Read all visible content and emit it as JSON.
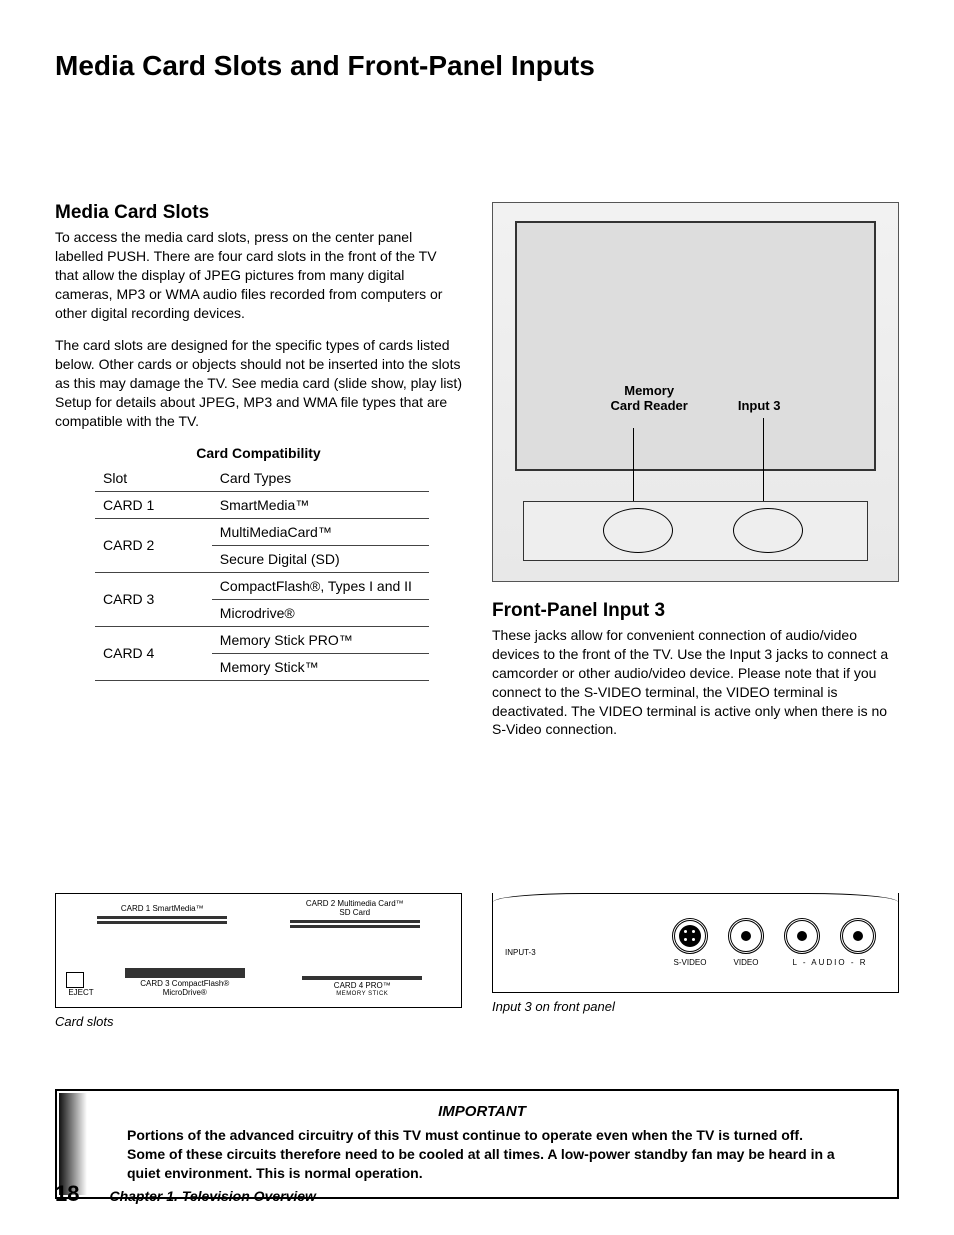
{
  "page_title": "Media Card Slots and Front-Panel Inputs",
  "section_media_slots": {
    "heading": "Media Card Slots",
    "p1": "To access the media card slots, press on the center panel labelled PUSH.  There are four card slots in the front of the TV that allow the display of JPEG pictures from many digital cameras, MP3 or WMA audio files recorded from computers or other digital recording devices.",
    "p2": "The card slots are designed for the specific types of cards listed below.  Other cards or objects should not be inserted into the slots as this may damage the TV.  See media card (slide show, play list) Setup for details about JPEG, MP3 and WMA file types that are compatible with the TV."
  },
  "compat_table": {
    "title": "Card Compatibility",
    "head_slot": "Slot",
    "head_types": "Card Types",
    "rows": [
      {
        "slot": "CARD 1",
        "types": [
          "SmartMedia™"
        ]
      },
      {
        "slot": "CARD 2",
        "types": [
          "MultiMediaCard™",
          "Secure Digital (SD)"
        ]
      },
      {
        "slot": "CARD 3",
        "types": [
          "CompactFlash®, Types I and II",
          "Microdrive®"
        ]
      },
      {
        "slot": "CARD 4",
        "types": [
          "Memory Stick PRO™",
          "Memory Stick™"
        ]
      }
    ]
  },
  "tv_figure": {
    "label_reader_l1": "Memory",
    "label_reader_l2": "Card Reader",
    "label_input3": "Input 3"
  },
  "section_front_input": {
    "heading": "Front-Panel Input 3",
    "p1": "These jacks allow for convenient connection of audio/video devices to the front of the TV.  Use the Input 3 jacks to connect a camcorder or other audio/video device.  Please note that if you connect to the S-VIDEO terminal, the VIDEO terminal is deactivated.  The VIDEO terminal is active only when there is no S-Video connection."
  },
  "card_slots_fig": {
    "c1": "CARD 1 SmartMedia™",
    "c2_l1": "CARD 2  Multimedia Card™",
    "c2_l2": "SD Card",
    "c3_l1": "CARD 3  CompactFlash®",
    "c3_l2": "MicroDrive®",
    "c4_l1": "CARD 4        PRO™",
    "c4_l2": "MEMORY STICK",
    "eject": "EJECT",
    "caption": "Card slots"
  },
  "input3_fig": {
    "panel": "INPUT-3",
    "svideo": "S-VIDEO",
    "video": "VIDEO",
    "audio": "L  -  AUDIO  -  R",
    "caption": "Input 3 on front panel"
  },
  "important": {
    "title": "IMPORTANT",
    "text": "Portions of the advanced circuitry of this TV must continue to operate even when the TV is turned off.  Some of these circuits therefore need to be cooled at all times.  A low-power standby fan may be heard in a quiet environment.  This is normal operation."
  },
  "footer": {
    "page": "18",
    "chapter": "Chapter 1. Television Overview"
  }
}
